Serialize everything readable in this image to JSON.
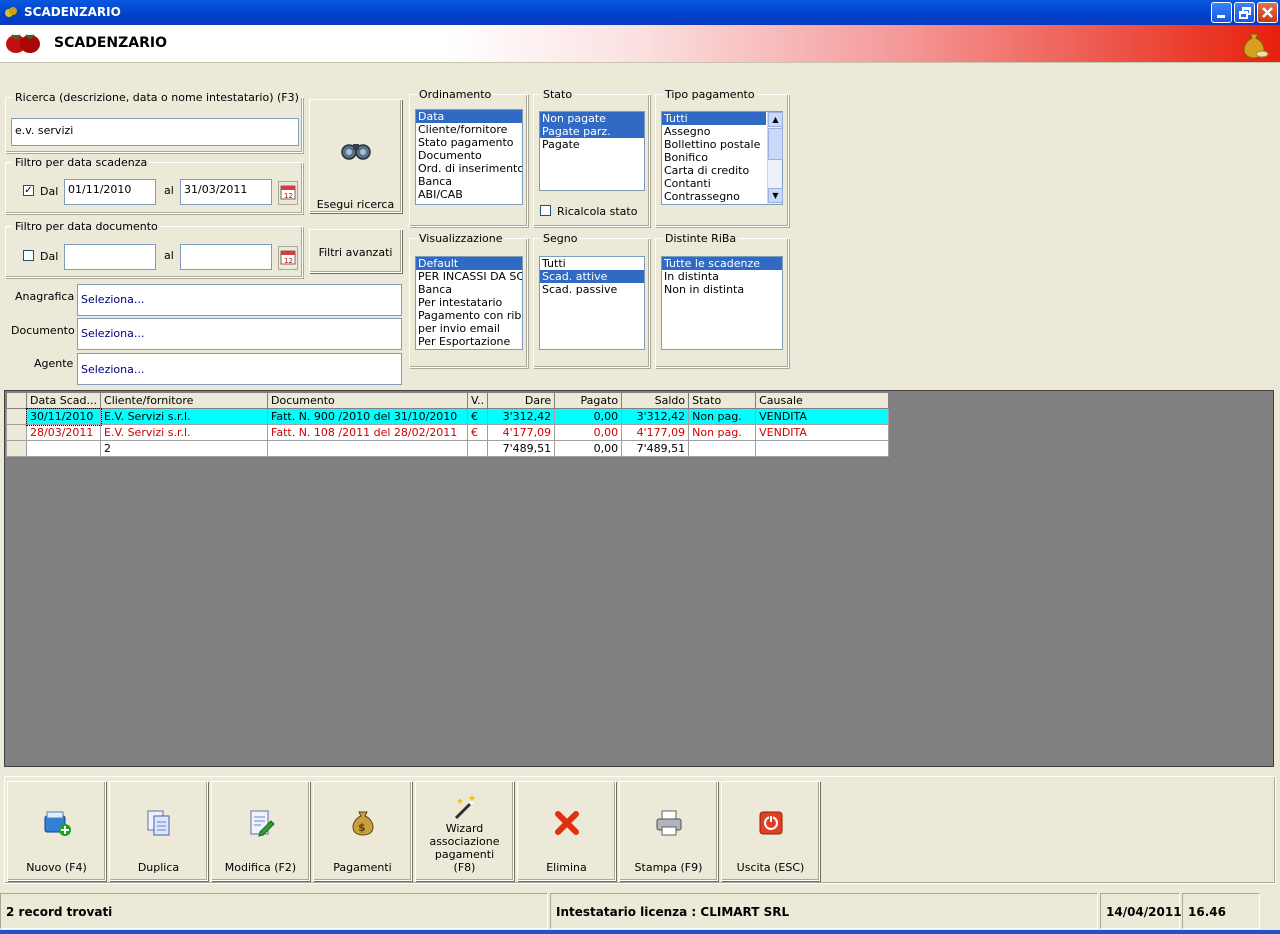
{
  "window": {
    "title": "SCADENZARIO"
  },
  "header": {
    "title": "SCADENZARIO"
  },
  "search": {
    "legend": "Ricerca (descrizione, data o nome intestatario) (F3)",
    "value": "e.v. servizi",
    "button_label": "Esegui ricerca"
  },
  "filter_due": {
    "legend": "Filtro per data scadenza",
    "checked": true,
    "dal_label": "Dal",
    "from": "01/11/2010",
    "al_label": "al",
    "to": "31/03/2011"
  },
  "filter_doc": {
    "legend": "Filtro per data documento",
    "checked": false,
    "dal_label": "Dal",
    "from": "",
    "al_label": "al",
    "to": ""
  },
  "advanced_filters_label": "Filtri avanzati",
  "anagrafica": {
    "label": "Anagrafica :",
    "value": "Seleziona..."
  },
  "documento": {
    "label": "Documento :",
    "value": "Seleziona..."
  },
  "agente": {
    "label": "Agente :",
    "value": "Seleziona..."
  },
  "ordinamento": {
    "legend": "Ordinamento",
    "items": [
      "Data",
      "Cliente/fornitore",
      "Stato pagamento",
      "Documento",
      "Ord. di inserimento",
      "Banca",
      "ABI/CAB"
    ],
    "selected": [
      0
    ]
  },
  "stato": {
    "legend": "Stato",
    "items": [
      "Non pagate",
      "Pagate parz.",
      "Pagate"
    ],
    "selected": [
      0,
      1
    ],
    "ricalcola_label": "Ricalcola stato"
  },
  "tipo_pagamento": {
    "legend": "Tipo pagamento",
    "items": [
      "Tutti",
      "Assegno",
      "Bollettino postale",
      "Bonifico",
      "Carta di credito",
      "Contanti",
      "Contrassegno"
    ],
    "selected": [
      0
    ]
  },
  "visualizzazione": {
    "legend": "Visualizzazione",
    "items": [
      "Default",
      "PER INCASSI DA SCO",
      "Banca",
      "Per intestatario",
      "Pagamento con riba",
      "per invio email",
      "Per Esportazione"
    ],
    "selected": [
      0
    ]
  },
  "segno": {
    "legend": "Segno",
    "items": [
      "Tutti",
      "Scad. attive",
      "Scad. passive"
    ],
    "selected": [
      1
    ]
  },
  "distinte": {
    "legend": "Distinte RiBa",
    "items": [
      "Tutte le scadenze",
      "In distinta",
      "Non in distinta"
    ],
    "selected": [
      0
    ]
  },
  "table": {
    "headers": [
      "Data Scad...",
      "Cliente/fornitore",
      "Documento",
      "V..",
      "Dare",
      "Pagato",
      "Saldo",
      "Stato",
      "Causale"
    ],
    "rows": [
      [
        "30/11/2010",
        "E.V. Servizi s.r.l.",
        "Fatt. N. 900 /2010 del 31/10/2010",
        "€",
        "3'312,42",
        "0,00",
        "3'312,42",
        "Non pag.",
        "VENDITA"
      ],
      [
        "28/03/2011",
        "E.V. Servizi s.r.l.",
        "Fatt. N. 108 /2011 del 28/02/2011",
        "€",
        "4'177,09",
        "0,00",
        "4'177,09",
        "Non pag.",
        "VENDITA"
      ]
    ],
    "totals": [
      "",
      "2",
      "",
      "",
      "7'489,51",
      "0,00",
      "7'489,51",
      "",
      ""
    ]
  },
  "toolbar": [
    {
      "label": "Nuovo (F4)",
      "icon": "new-icon"
    },
    {
      "label": "Duplica",
      "icon": "duplicate-icon"
    },
    {
      "label": "Modifica (F2)",
      "icon": "edit-icon"
    },
    {
      "label": "Pagamenti",
      "icon": "money-bag-icon"
    },
    {
      "label": "Wizard associazione pagamenti (F8)",
      "icon": "wizard-icon"
    },
    {
      "label": "Elimina",
      "icon": "delete-icon"
    },
    {
      "label": "Stampa (F9)",
      "icon": "printer-icon"
    },
    {
      "label": "Uscita (ESC)",
      "icon": "exit-icon"
    }
  ],
  "status": {
    "records": "2 record trovati",
    "license": "Intestatario licenza : CLIMART SRL",
    "date": "14/04/2011",
    "time": "16.46"
  },
  "colors": {
    "title_blue": "#0a58e0",
    "selection": "#316ac5",
    "highlight_row": "#00ffff",
    "red_text": "#d00000",
    "grid_bg": "#808080"
  }
}
